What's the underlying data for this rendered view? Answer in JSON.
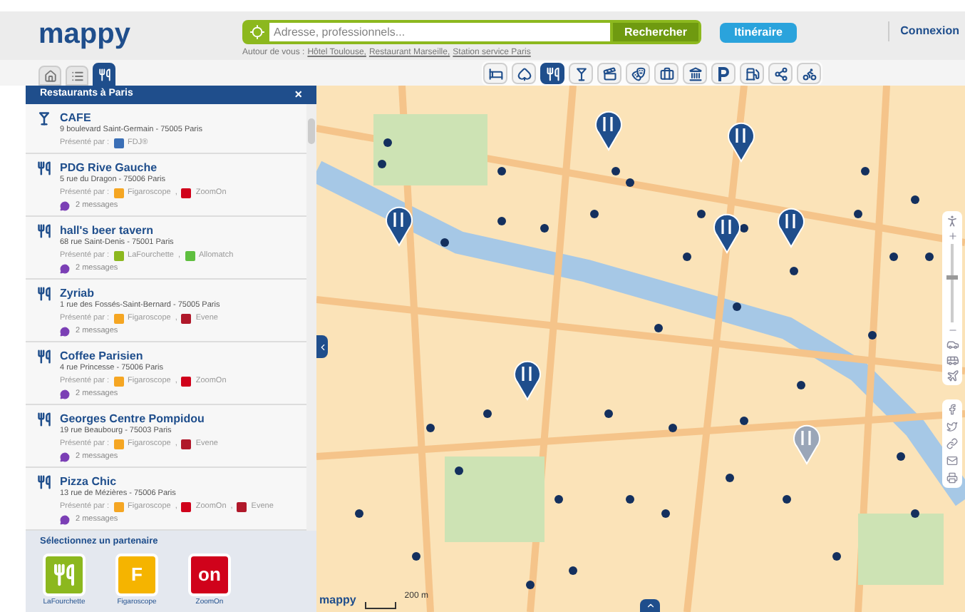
{
  "header": {
    "logo": "mappy",
    "search": {
      "placeholder": "Adresse, professionnels...",
      "button": "Rechercher"
    },
    "suggestions_label": "Autour de vous :",
    "suggestions": [
      "Hôtel Toulouse,",
      "Restaurant Marseille,",
      "Station service Paris"
    ],
    "itinerary_button": "Itinéraire",
    "login_link": "Connexion"
  },
  "view_tabs": [
    {
      "selected": false
    },
    {
      "selected": false
    },
    {
      "selected": true
    }
  ],
  "categories": [
    {
      "selected": false
    },
    {
      "selected": false
    },
    {
      "selected": true
    },
    {
      "selected": false
    },
    {
      "selected": false
    },
    {
      "selected": false
    },
    {
      "selected": false
    },
    {
      "selected": false
    },
    {
      "selected": false
    },
    {
      "selected": false
    },
    {
      "selected": false
    },
    {
      "selected": false
    }
  ],
  "panel": {
    "title": "Restaurants à Paris",
    "close": "×",
    "partner_separator": ",",
    "results": [
      {
        "kind": "bar",
        "name": "CAFE",
        "address": "9 boulevard Saint-Germain - 75005 Paris",
        "presented_label": "Présenté par :",
        "partners": [
          {
            "name": "FDJ®",
            "color": "#3b6fb6"
          }
        ]
      },
      {
        "kind": "restaurant",
        "name": "PDG Rive Gauche",
        "address": "5 rue du Dragon - 75006 Paris",
        "presented_label": "Présenté par :",
        "partners": [
          {
            "name": "Figaroscope",
            "color": "#f5a623"
          },
          {
            "name": "ZoomOn",
            "color": "#d0021b"
          }
        ],
        "messages": "2 messages"
      },
      {
        "kind": "restaurant",
        "name": "hall's beer tavern",
        "address": "68 rue Saint-Denis - 75001 Paris",
        "presented_label": "Présenté par :",
        "partners": [
          {
            "name": "LaFourchette",
            "color": "#8cb81e"
          },
          {
            "name": "Allomatch",
            "color": "#5fbf3f"
          }
        ],
        "messages": "2 messages"
      },
      {
        "kind": "restaurant",
        "name": "Zyriab",
        "address": "1 rue des Fossés-Saint-Bernard - 75005 Paris",
        "presented_label": "Présenté par :",
        "partners": [
          {
            "name": "Figaroscope",
            "color": "#f5a623"
          },
          {
            "name": "Evene",
            "color": "#b0182a"
          }
        ],
        "messages": "2 messages"
      },
      {
        "kind": "restaurant",
        "name": "Coffee Parisien",
        "address": "4 rue Princesse - 75006 Paris",
        "presented_label": "Présenté par :",
        "partners": [
          {
            "name": "Figaroscope",
            "color": "#f5a623"
          },
          {
            "name": "ZoomOn",
            "color": "#d0021b"
          }
        ],
        "messages": "2 messages"
      },
      {
        "kind": "restaurant",
        "name": "Georges Centre Pompidou",
        "address": "19 rue Beaubourg - 75003 Paris",
        "presented_label": "Présenté par :",
        "partners": [
          {
            "name": "Figaroscope",
            "color": "#f5a623"
          },
          {
            "name": "Evene",
            "color": "#b0182a"
          }
        ],
        "messages": "2 messages"
      },
      {
        "kind": "restaurant",
        "name": "Pizza Chic",
        "address": "13 rue de Mézières - 75006 Paris",
        "presented_label": "Présenté par :",
        "partners": [
          {
            "name": "Figaroscope",
            "color": "#f5a623"
          },
          {
            "name": "ZoomOn",
            "color": "#d0021b"
          },
          {
            "name": "Evene",
            "color": "#b0182a"
          }
        ],
        "messages": "2 messages"
      }
    ],
    "partner_section": {
      "title": "Sélectionnez un partenaire",
      "partners": [
        {
          "name": "LaFourchette",
          "color": "#8cb81e"
        },
        {
          "name": "Figaroscope",
          "logo": "F",
          "color": "#f5b400"
        },
        {
          "name": "ZoomOn",
          "logo": "on",
          "color": "#d0021b"
        }
      ]
    }
  },
  "map": {
    "scale": "200 m",
    "logo": "mappy"
  }
}
